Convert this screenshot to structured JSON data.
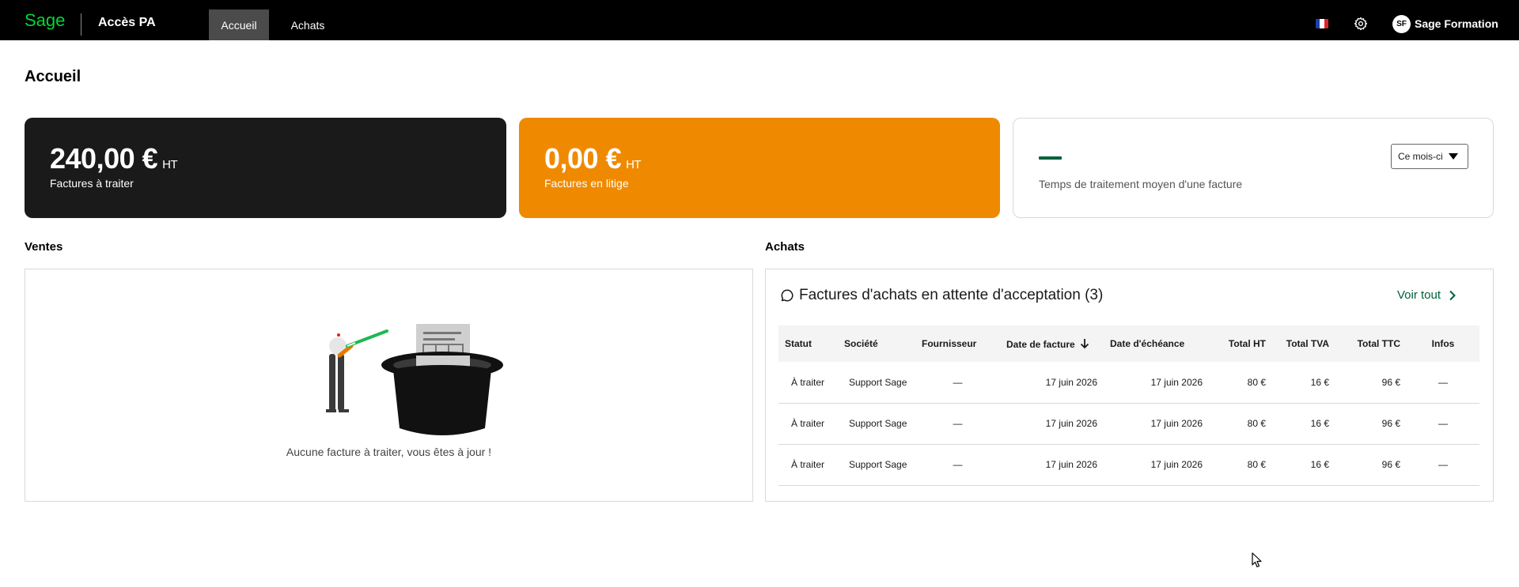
{
  "colors": {
    "topbar_bg": "#000000",
    "brand_green": "#00d639",
    "accent_green": "#00613a",
    "card_dark": "#1a1a1a",
    "card_orange": "#ef8a00",
    "nav_active_bg": "#4b4b4b"
  },
  "topbar": {
    "logo_icon": "sage-logo",
    "app_name": "Accès PA",
    "tabs": [
      {
        "label": "Accueil",
        "active": true
      },
      {
        "label": "Achats",
        "active": false
      }
    ],
    "language_icon": "france-flag-icon",
    "settings_icon": "gear-icon",
    "user": {
      "initials": "SF",
      "name": "Sage Formation"
    }
  },
  "page": {
    "title": "Accueil"
  },
  "kpis": [
    {
      "value": "240,00 €",
      "unit": "HT",
      "label": "Factures à traiter"
    },
    {
      "value": "0,00 €",
      "unit": "HT",
      "label": "Factures en litige"
    },
    {
      "value": "—",
      "label": "Temps de traitement moyen d'une facture",
      "period_select": "Ce mois-ci"
    }
  ],
  "ventes": {
    "title": "Ventes",
    "illustration_icon": "magician-hat-illustration",
    "empty_message": "Aucune facture à traiter, vous êtes à jour !"
  },
  "achats": {
    "title": "Achats",
    "panel_title": "Factures d'achats en attente d'acceptation (3)",
    "see_all": "Voir tout",
    "columns": [
      "Statut",
      "Société",
      "Fournisseur",
      "Date de facture",
      "Date d'échéance",
      "Total HT",
      "Total TVA",
      "Total TTC",
      "Infos"
    ],
    "sorted_column": "Date de facture",
    "rows": [
      [
        "À traiter",
        "Support Sage",
        "—",
        "17 juin 2026",
        "17 juin 2026",
        "80 €",
        "16 €",
        "96 €",
        "—"
      ],
      [
        "À traiter",
        "Support Sage",
        "—",
        "17 juin 2026",
        "17 juin 2026",
        "80 €",
        "16 €",
        "96 €",
        "—"
      ],
      [
        "À traiter",
        "Support Sage",
        "—",
        "17 juin 2026",
        "17 juin 2026",
        "80 €",
        "16 €",
        "96 €",
        "—"
      ]
    ]
  }
}
